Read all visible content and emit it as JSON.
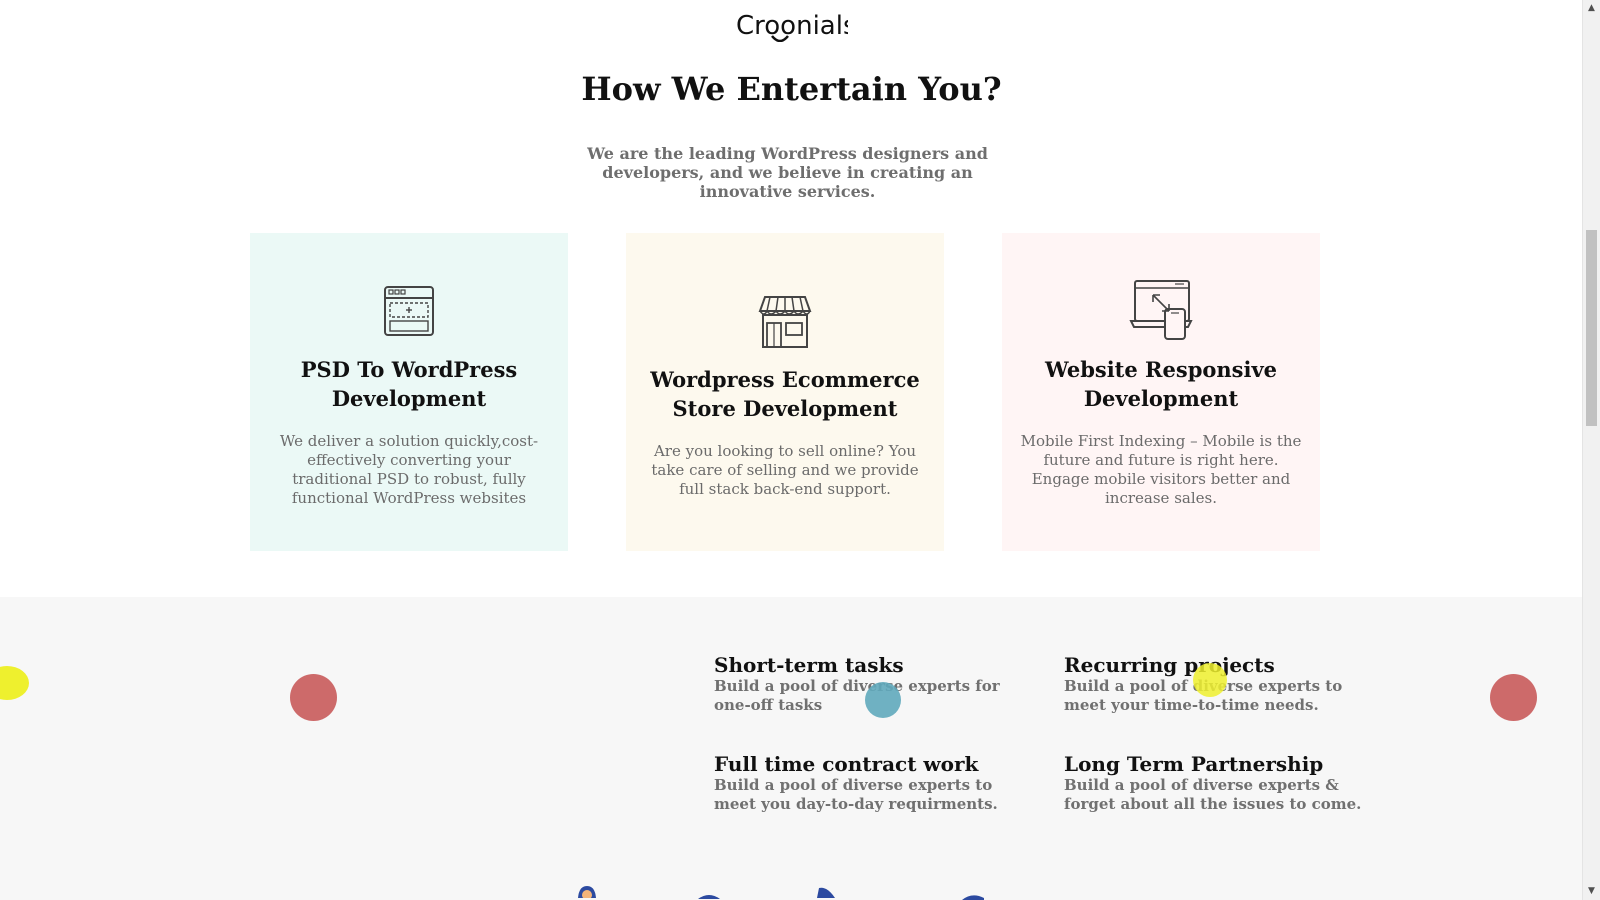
{
  "brand": {
    "logo": "Croonials"
  },
  "section": {
    "title": "How We Entertain You?",
    "subtitle": "We are the leading WordPress designers and developers, and we believe in creating an innovative services."
  },
  "services": [
    {
      "icon": "browser-window-icon",
      "title": "PSD To WordPress Development",
      "description": "We deliver a solution quickly,cost-effectively converting your traditional PSD to robust, fully functional WordPress websites",
      "bg": "#ebf9f6"
    },
    {
      "icon": "storefront-icon",
      "title": "Wordpress Ecommerce Store Development",
      "description": "Are you looking to sell online? You take care of selling and we provide full stack back-end support.",
      "bg": "#fdf9ee"
    },
    {
      "icon": "responsive-devices-icon",
      "title": "Website Responsive Development",
      "description": "Mobile First Indexing – Mobile is the future and future is right here. Engage mobile visitors better and increase sales.",
      "bg": "#fff5f5"
    }
  ],
  "features": [
    {
      "title": "Short-term tasks",
      "description": "Build a pool of diverse experts for one-off tasks"
    },
    {
      "title": "Recurring projects",
      "description": "Build a pool of diverse experts to meet your time-to-time needs."
    },
    {
      "title": "Full time contract work",
      "description": "Build a pool of diverse experts to meet you day-to-day requirments."
    },
    {
      "title": "Long Term Partnership",
      "description": "Build a pool of diverse experts & forget about all the issues to come."
    }
  ],
  "colors": {
    "dot_red": "#cd6a6a",
    "dot_yellow": "#eef02e",
    "dot_blue": "#5fa8bb",
    "grey_bg": "#f7f7f7"
  }
}
